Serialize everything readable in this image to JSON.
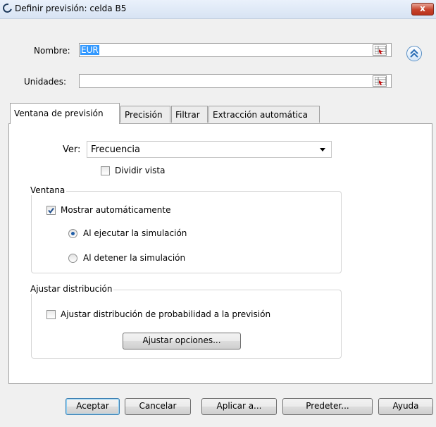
{
  "window": {
    "title": "Definir previsión: celda B5",
    "close_label": "x"
  },
  "fields": {
    "nombre_label": "Nombre:",
    "nombre_value": "EUR",
    "unidades_label": "Unidades:",
    "unidades_value": ""
  },
  "tabs": [
    {
      "label": "Ventana de previsión",
      "active": true
    },
    {
      "label": "Precisión",
      "active": false
    },
    {
      "label": "Filtrar",
      "active": false
    },
    {
      "label": "Extracción automática",
      "active": false
    }
  ],
  "view": {
    "label": "Ver:",
    "selected": "Frecuencia",
    "split_label": "Dividir vista",
    "split_checked": false
  },
  "window_group": {
    "legend": "Ventana",
    "auto_show_label": "Mostrar automáticamente",
    "auto_show_checked": true,
    "radio_run": "Al ejecutar la simulación",
    "radio_stop": "Al detener la simulación",
    "selected": "run"
  },
  "fit_group": {
    "legend": "Ajustar distribución",
    "fit_label": "Ajustar distribución de probabilidad a la previsión",
    "fit_checked": false,
    "options_button": "Ajustar opciones..."
  },
  "buttons": {
    "accept": "Aceptar",
    "cancel": "Cancelar",
    "apply": "Aplicar a...",
    "defaults": "Predeter...",
    "help": "Ayuda"
  },
  "colors": {
    "selection": "#3399ff",
    "close_button": "#c7432b",
    "radio_dot": "#1f5ea8"
  },
  "icons": {
    "cell_ref": "cell-reference-icon",
    "expand": "double-chevron-up-icon",
    "check": "checkmark-icon"
  }
}
